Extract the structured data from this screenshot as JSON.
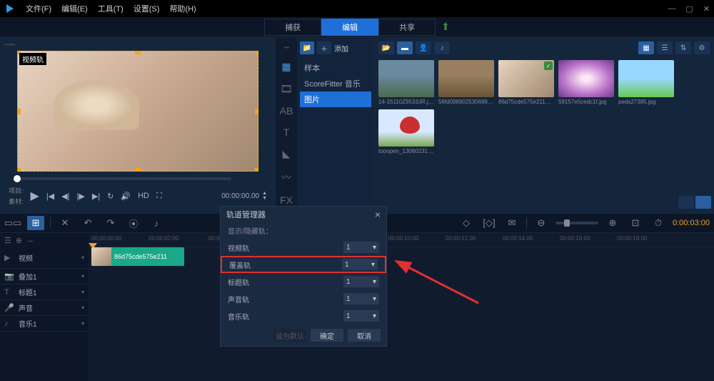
{
  "menubar": {
    "items": [
      "文件(F)",
      "编辑(E)",
      "工具(T)",
      "设置(S)",
      "帮助(H)"
    ]
  },
  "tabs": {
    "capture": "捕获",
    "edit": "编辑",
    "share": "共享"
  },
  "preview": {
    "track_label": "视频轨",
    "project_label": "项目:",
    "clip_label": "素材:",
    "timecode": "00:00:00.00",
    "timecode_up": "▲",
    "timecode_dn": "▼"
  },
  "library": {
    "add_label": "添加",
    "tree": {
      "sample": "样本",
      "scorefitter": "ScoreFitter 音乐",
      "pictures": "图片"
    },
    "thumbs": [
      {
        "caption": "14-15110Z9533JR.jpg"
      },
      {
        "caption": "56fd0989025306996…"
      },
      {
        "caption": "86d75cde575e211d5…"
      },
      {
        "caption": "59157e5cedc1f.jpg"
      },
      {
        "caption": "peds27385.jpg"
      },
      {
        "caption": "tooopen_13060231.jpg"
      }
    ]
  },
  "timeline": {
    "ruler_left": [
      "00:00:00:00",
      "00:00:02:00",
      "00:00:04:00"
    ],
    "ruler_right": [
      "00:00:10.00",
      "00:00:12.00",
      "00:00:14.00",
      "00:00:16.00",
      "00:00:18.00"
    ],
    "end_time": "0:00:03:00",
    "tracks": {
      "video": "视频",
      "overlay": "叠加1",
      "title": "标题1",
      "voice": "声音",
      "music": "音乐1"
    },
    "clip_label": "86d75cde575e211"
  },
  "dialog": {
    "title": "轨道管理器",
    "subtitle": "显示/隐藏轨：",
    "rows": {
      "video": "视频轨",
      "overlay": "覆盖轨",
      "title": "标题轨",
      "voice": "声音轨",
      "music": "音乐轨"
    },
    "value": "1",
    "btn_default": "设为默认",
    "btn_ok": "确定",
    "btn_cancel": "取消"
  }
}
